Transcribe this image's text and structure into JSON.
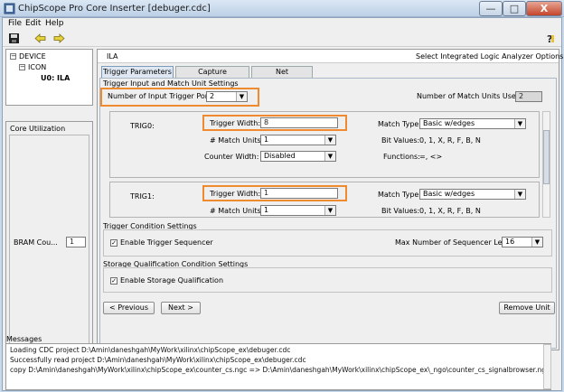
{
  "window": {
    "title": "ChipScope Pro Core Inserter [debuger.cdc]",
    "min_label": "—",
    "max_label": "□",
    "close_label": "X"
  },
  "menu": [
    {
      "label": "File"
    },
    {
      "label": "Edit"
    },
    {
      "label": "Help"
    }
  ],
  "tree": {
    "items": [
      {
        "label": "DEVICE",
        "box": "−"
      },
      {
        "label": "ICON",
        "box": "−"
      },
      {
        "label": "U0: ILA",
        "box": ""
      }
    ]
  },
  "core_utilization": {
    "title": "Core Utilization",
    "row_label": "BRAM Cou...",
    "row_value": "1"
  },
  "panel": {
    "name": "ILA",
    "description": "Select Integrated Logic Analyzer Options",
    "tabs": [
      "Trigger Parameters",
      "Capture Parameters",
      "Net Connections"
    ],
    "active_tab": "Trigger Parameters"
  },
  "trigger_input": {
    "group_title": "Trigger Input and Match Unit Settings",
    "num_ports_label": "Number of Input Trigger Ports:",
    "num_ports_value": "2",
    "match_units_used_label": "Number of Match Units Used:",
    "match_units_used_value": "2",
    "trig0": {
      "name": "TRIG0:",
      "width_label": "Trigger Width:",
      "width_value": "8",
      "match_units_label": "# Match Units:",
      "match_units_value": "1",
      "counter_width_label": "Counter Width:",
      "counter_width_value": "Disabled",
      "match_type_label": "Match Type:",
      "match_type_value": "Basic w/edges",
      "bit_values_label": "Bit Values:",
      "bit_values_value": "0, 1, X, R, F, B, N",
      "functions_label": "Functions:",
      "functions_value": "=, <>"
    },
    "trig1": {
      "name": "TRIG1:",
      "width_label": "Trigger Width:",
      "width_value": "1",
      "match_units_label": "# Match Units:",
      "match_units_value": "1",
      "match_type_label": "Match Type:",
      "match_type_value": "Basic w/edges",
      "bit_values_label": "Bit Values:",
      "bit_values_value": "0, 1, X, R, F, B, N"
    }
  },
  "trigger_condition": {
    "group_title": "Trigger Condition Settings",
    "enable_sequencer_label": "Enable Trigger Sequencer",
    "max_levels_label": "Max Number of Sequencer Levels:",
    "max_levels_value": "16"
  },
  "storage": {
    "group_title": "Storage Qualification Condition Settings",
    "enable_label": "Enable Storage Qualification"
  },
  "nav": {
    "previous": "< Previous",
    "next": "Next >",
    "remove": "Remove Unit"
  },
  "messages": {
    "title": "Messages",
    "lines": [
      "Loading CDC project D:\\Amin\\daneshgah\\MyWork\\xilinx\\chipScope_ex\\debuger.cdc",
      "Successfully read project D:\\Amin\\daneshgah\\MyWork\\xilinx\\chipScope_ex\\debuger.cdc",
      "copy D:\\Amin\\daneshgah\\MyWork\\xilinx\\chipScope_ex\\counter_cs.ngc => D:\\Amin\\daneshgah\\MyWork\\xilinx\\chipScope_ex\\_ngo\\counter_cs_signalbrowser.ngo"
    ]
  },
  "colors": {
    "highlight": "#f08a2e",
    "titlebar": "#c9d9ea"
  }
}
